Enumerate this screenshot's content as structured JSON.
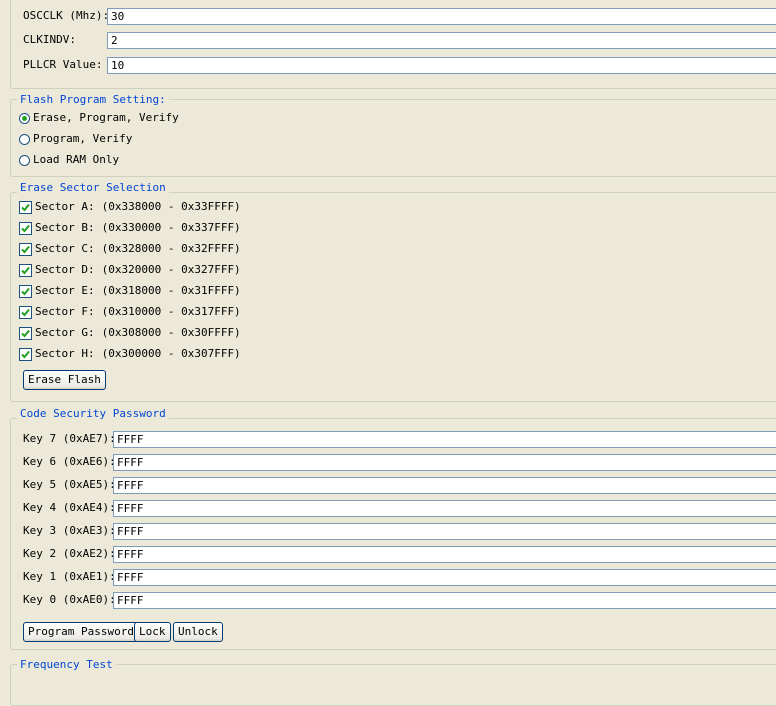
{
  "clock": {
    "fields": [
      {
        "label": "OSCCLK (Mhz):",
        "value": "30"
      },
      {
        "label": "CLKINDV:",
        "value": "2"
      },
      {
        "label": "PLLCR Value:",
        "value": "10"
      }
    ]
  },
  "flash_program": {
    "legend": "Flash Program Setting:",
    "options": [
      {
        "label": "Erase, Program, Verify",
        "selected": true
      },
      {
        "label": "Program, Verify",
        "selected": false
      },
      {
        "label": "Load RAM Only",
        "selected": false
      }
    ]
  },
  "erase_sectors": {
    "legend": "Erase Sector Selection",
    "sectors": [
      {
        "label": "Sector A:",
        "range": "(0x338000 - 0x33FFFF)",
        "checked": true
      },
      {
        "label": "Sector B:",
        "range": "(0x330000 - 0x337FFF)",
        "checked": true
      },
      {
        "label": "Sector C:",
        "range": "(0x328000 - 0x32FFFF)",
        "checked": true
      },
      {
        "label": "Sector D:",
        "range": "(0x320000 - 0x327FFF)",
        "checked": true
      },
      {
        "label": "Sector E:",
        "range": "(0x318000 - 0x31FFFF)",
        "checked": true
      },
      {
        "label": "Sector F:",
        "range": "(0x310000 - 0x317FFF)",
        "checked": true
      },
      {
        "label": "Sector G:",
        "range": "(0x308000 - 0x30FFFF)",
        "checked": true
      },
      {
        "label": "Sector H:",
        "range": "(0x300000 - 0x307FFF)",
        "checked": true
      }
    ],
    "erase_button": "Erase Flash"
  },
  "security": {
    "legend": "Code Security Password",
    "keys": [
      {
        "label": "Key 7 (0xAE7):",
        "value": "FFFF"
      },
      {
        "label": "Key 6 (0xAE6):",
        "value": "FFFF"
      },
      {
        "label": "Key 5 (0xAE5):",
        "value": "FFFF"
      },
      {
        "label": "Key 4 (0xAE4):",
        "value": "FFFF"
      },
      {
        "label": "Key 3 (0xAE3):",
        "value": "FFFF"
      },
      {
        "label": "Key 2 (0xAE2):",
        "value": "FFFF"
      },
      {
        "label": "Key 1 (0xAE1):",
        "value": "FFFF"
      },
      {
        "label": "Key 0 (0xAE0):",
        "value": "FFFF"
      }
    ],
    "buttons": {
      "program": "Program Password",
      "lock": "Lock",
      "unlock": "Unlock"
    }
  },
  "frequency": {
    "legend": "Frequency Test"
  }
}
